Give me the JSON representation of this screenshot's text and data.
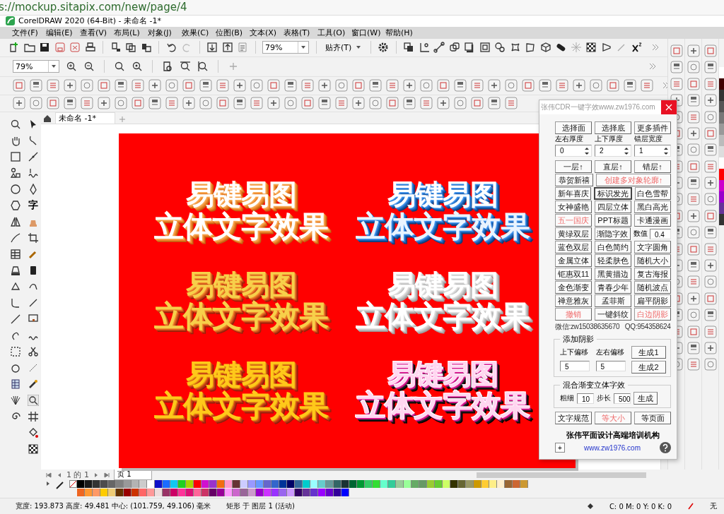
{
  "browser": {
    "url": "s://mockup.sitapix.com/new/page/4"
  },
  "window": {
    "title": "CorelDRAW 2020 (64-Bit) - 未命名 -1*"
  },
  "menu": [
    "文件(F)",
    "编辑(E)",
    "查看(V)",
    "布局(L)",
    "对象(J)",
    "效果(C)",
    "位图(B)",
    "文本(X)",
    "表格(T)",
    "工具(O)",
    "窗口(W)",
    "帮助(H)"
  ],
  "toolbar": {
    "zoom_value": "79%",
    "snap_label": "贴齐(T)"
  },
  "zoom_toolbar": {
    "zoom_value": "79%"
  },
  "document_tab": "未命名 -1*",
  "toolbox": {
    "text_tool": "字"
  },
  "artworks": [
    {
      "kind": "orange",
      "line_1": "易键易图",
      "line_2": "立体文字效果"
    },
    {
      "kind": "blue",
      "line_1": "易键易图",
      "line_2": "立体文字效果"
    },
    {
      "kind": "gold",
      "line_1": "易键易图",
      "line_2": "立体文字效果"
    },
    {
      "kind": "white",
      "line_1": "易键易图",
      "line_2": "立体文字效果"
    },
    {
      "kind": "golden",
      "line_1": "易键易图",
      "line_2": "立体文字效果"
    },
    {
      "kind": "magenta",
      "line_1": "易键易图",
      "line_2": "立体文字效果"
    }
  ],
  "plugin": {
    "title": "张伟CDR一键字效www.zw1976.com",
    "top_buttons": [
      "选择面",
      "选择底",
      "更多插件"
    ],
    "spinners": [
      {
        "label": "左右厚度",
        "value": "0"
      },
      {
        "label": "上下厚度",
        "value": "2"
      },
      {
        "label": "错层宽度",
        "value": "1"
      }
    ],
    "button_rows": [
      [
        {
          "kind": "button",
          "label": "一层↑",
          "emphasized": false,
          "focused": false
        },
        {
          "kind": "button",
          "label": "直层↑",
          "emphasized": false,
          "focused": false
        },
        {
          "kind": "button",
          "label": "错层↑",
          "emphasized": false,
          "focused": false
        }
      ],
      [
        {
          "kind": "button",
          "label": "恭贺新禧",
          "emphasized": false,
          "focused": false
        },
        {
          "kind": "button",
          "label": "创建多对象轮廓↑",
          "emphasized": true,
          "focused": false
        }
      ],
      [
        {
          "kind": "button",
          "label": "新年喜庆",
          "emphasized": false,
          "focused": false
        },
        {
          "kind": "button",
          "label": "标识发光",
          "emphasized": false,
          "focused": true
        },
        {
          "kind": "button",
          "label": "白色雪帮",
          "emphasized": false,
          "focused": false
        }
      ],
      [
        {
          "kind": "button",
          "label": "女神盛艳",
          "emphasized": false,
          "focused": false
        },
        {
          "kind": "button",
          "label": "四层立体",
          "emphasized": false,
          "focused": false
        },
        {
          "kind": "button",
          "label": "黑白高光",
          "emphasized": false,
          "focused": false
        }
      ],
      [
        {
          "kind": "button",
          "label": "五一国庆",
          "emphasized": true,
          "focused": false
        },
        {
          "kind": "button",
          "label": "PPT标题",
          "emphasized": false,
          "focused": false
        },
        {
          "kind": "button",
          "label": "卡通漫画",
          "emphasized": false,
          "focused": false
        }
      ],
      [
        {
          "kind": "button",
          "label": "黄绿双层",
          "emphasized": false,
          "focused": false
        },
        {
          "kind": "button",
          "label": "渐隐字效",
          "emphasized": false,
          "focused": false
        },
        {
          "kind": "field",
          "label": "数值",
          "value": "0.4"
        }
      ],
      [
        {
          "kind": "button",
          "label": "蓝色双层",
          "emphasized": false,
          "focused": false
        },
        {
          "kind": "button",
          "label": "白色简约",
          "emphasized": false,
          "focused": false
        },
        {
          "kind": "button",
          "label": "文字圆角",
          "emphasized": false,
          "focused": false
        }
      ],
      [
        {
          "kind": "button",
          "label": "金属立体",
          "emphasized": false,
          "focused": false
        },
        {
          "kind": "button",
          "label": "轻柔肤色",
          "emphasized": false,
          "focused": false
        },
        {
          "kind": "button",
          "label": "随机大小",
          "emphasized": false,
          "focused": false
        }
      ],
      [
        {
          "kind": "button",
          "label": "钜惠双11",
          "emphasized": false,
          "focused": false
        },
        {
          "kind": "button",
          "label": "黑黄描边",
          "emphasized": false,
          "focused": false
        },
        {
          "kind": "button",
          "label": "复古海报",
          "emphasized": false,
          "focused": false
        }
      ],
      [
        {
          "kind": "button",
          "label": "金色渐变",
          "emphasized": false,
          "focused": false
        },
        {
          "kind": "button",
          "label": "青春少年",
          "emphasized": false,
          "focused": false
        },
        {
          "kind": "button",
          "label": "随机波点",
          "emphasized": false,
          "focused": false
        }
      ],
      [
        {
          "kind": "button",
          "label": "禅意雅灰",
          "emphasized": false,
          "focused": false
        },
        {
          "kind": "button",
          "label": "孟菲斯",
          "emphasized": false,
          "focused": false
        },
        {
          "kind": "button",
          "label": "扁平阴影",
          "emphasized": false,
          "focused": false
        }
      ],
      [
        {
          "kind": "button",
          "label": "撤销",
          "emphasized": true,
          "focused": false
        },
        {
          "kind": "button",
          "label": "一键斜纹",
          "emphasized": false,
          "focused": false
        },
        {
          "kind": "button",
          "label": "白边阴影",
          "emphasized": true,
          "focused": false
        }
      ]
    ],
    "contact": "微信:zw15038635670   QQ:954358624",
    "shadow_group": {
      "title": "添加阴影",
      "label_1": "上下偏移",
      "label_2": "左右偏移",
      "value_1": "5",
      "value_2": "5",
      "button_1": "生成1",
      "button_2": "生成2"
    },
    "blend_group": {
      "title": "混合渐变立体字效",
      "label_1": "粗细",
      "value_1": "10",
      "label_2": "步长",
      "value_2": "500",
      "button": "生成"
    },
    "bottom_buttons": [
      {
        "label": "文字规范",
        "emphasized": false
      },
      {
        "label": "等大小",
        "emphasized": true
      },
      {
        "label": "等页面",
        "emphasized": false
      }
    ],
    "footer": "张伟平面设计高端培训机构",
    "expand_button": "+",
    "link": "www.zw1976.com"
  },
  "page_nav": {
    "position": "1 的 1",
    "tab": "页 1"
  },
  "palette": {
    "rows": [
      [
        {
          "color": "#000000"
        },
        {
          "color": "#1a1a1a"
        },
        {
          "color": "#333333"
        },
        {
          "color": "#4d4d4d"
        },
        {
          "color": "#666666"
        },
        {
          "color": "#808080"
        },
        {
          "color": "#999999"
        },
        {
          "color": "#b3b3b3"
        },
        {
          "color": "#cccccc"
        },
        {
          "color": "#ffffff"
        },
        {
          "color": "#1010c8"
        },
        {
          "color": "#1a6cff"
        },
        {
          "color": "#12c8f0"
        },
        {
          "color": "#20d020"
        },
        {
          "color": "#a8d400"
        },
        {
          "color": "#ff0000"
        },
        {
          "color": "#d010d0"
        },
        {
          "color": "#9933cc"
        },
        {
          "color": "#f26c10"
        },
        {
          "color": "#ff99cc"
        },
        {
          "color": "#663333"
        },
        {
          "color": "#ccccff"
        },
        {
          "color": "#9999ff"
        },
        {
          "color": "#6699ff"
        },
        {
          "color": "#6666cc"
        },
        {
          "color": "#3366cc"
        },
        {
          "color": "#003399"
        },
        {
          "color": "#000066"
        },
        {
          "color": "#336699"
        },
        {
          "color": "#00cccc"
        },
        {
          "color": "#99ffff"
        },
        {
          "color": "#66cccc"
        },
        {
          "color": "#669999"
        },
        {
          "color": "#336666"
        },
        {
          "color": "#1a3333"
        },
        {
          "color": "#006633"
        },
        {
          "color": "#009933"
        },
        {
          "color": "#33cc66"
        },
        {
          "color": "#33dd33"
        },
        {
          "color": "#66ffcc"
        },
        {
          "color": "#33cc99"
        },
        {
          "color": "#99cc99"
        },
        {
          "color": "#99ff99"
        },
        {
          "color": "#66aa66"
        },
        {
          "color": "#669966"
        },
        {
          "color": "#99cc33"
        },
        {
          "color": "#66cc33"
        },
        {
          "color": "#ccff66"
        },
        {
          "color": "#333300"
        },
        {
          "color": "#666633"
        },
        {
          "color": "#999966"
        },
        {
          "color": "#cc9900"
        },
        {
          "color": "#ffcc33"
        },
        {
          "color": "#ffee88"
        },
        {
          "color": "#ffeecc"
        },
        {
          "color": "#996633"
        },
        {
          "color": "#cc6633"
        },
        {
          "color": "#cc9933"
        }
      ],
      [
        {
          "color": "#ee6622"
        },
        {
          "color": "#ff9933"
        },
        {
          "color": "#ff9966"
        },
        {
          "color": "#ffcc00"
        },
        {
          "color": "#eecc77"
        },
        {
          "color": "#663300"
        },
        {
          "color": "#990000"
        },
        {
          "color": "#cc3300"
        },
        {
          "color": "#ff6666"
        },
        {
          "color": "#ff9999"
        },
        {
          "color": "#eedddd"
        },
        {
          "color": "#993366"
        },
        {
          "color": "#cc0066"
        },
        {
          "color": "#ff3399"
        },
        {
          "color": "#dd1177"
        },
        {
          "color": "#ff6699"
        },
        {
          "color": "#cc3366"
        },
        {
          "color": "#660066"
        },
        {
          "color": "#990099"
        },
        {
          "color": "#ff99ff"
        },
        {
          "color": "#cc66cc"
        },
        {
          "color": "#996699"
        },
        {
          "color": "#cc99cc"
        },
        {
          "color": "#9900cc"
        },
        {
          "color": "#cc33ff"
        },
        {
          "color": "#9933ff"
        },
        {
          "color": "#9966ee"
        },
        {
          "color": "#cc99ff"
        },
        {
          "color": "#330066"
        },
        {
          "color": "#663399"
        },
        {
          "color": "#6633cc"
        },
        {
          "color": "#9900ff"
        },
        {
          "color": "#6600cc"
        },
        {
          "color": "#330099"
        },
        {
          "color": "#0000ff"
        }
      ]
    ]
  },
  "status_bar": {
    "size": "宽度: 193.873  高度: 49.481  中心: (101.759, 49.106)  毫米",
    "object": "矩形 于 图层 1 (活动)",
    "fill": "C: 0 M: 0 Y: 0 K: 0",
    "outline": "无"
  }
}
